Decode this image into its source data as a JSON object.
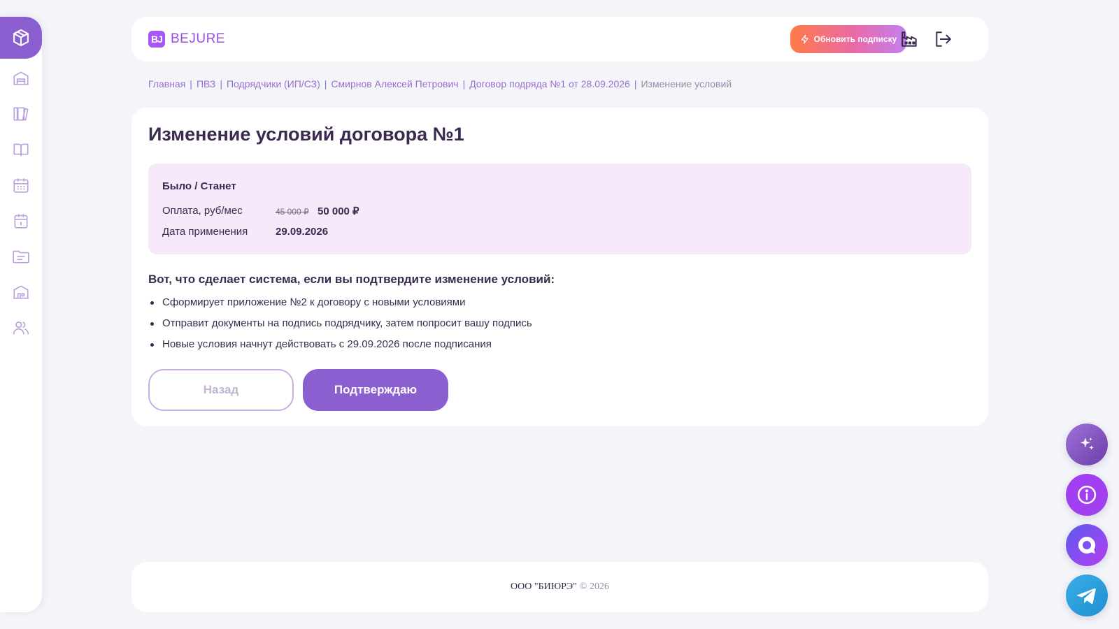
{
  "sidebar": {
    "items": [
      {
        "icon": "box-icon",
        "active": true
      },
      {
        "icon": "warehouse-icon"
      },
      {
        "icon": "library-icon"
      },
      {
        "icon": "book-icon"
      },
      {
        "icon": "calendar-grid-icon"
      },
      {
        "icon": "calendar-day-icon"
      },
      {
        "icon": "folder-icon"
      },
      {
        "icon": "building-icon"
      },
      {
        "icon": "users-icon"
      }
    ]
  },
  "header": {
    "logo_mark": "BJ",
    "logo_text": "BEJURE",
    "upgrade_label": "Обновить подписку",
    "icons": [
      "factory-icon",
      "logout-icon"
    ]
  },
  "breadcrumb": {
    "items": [
      "Главная",
      "ПВЗ",
      "Подрядчики (ИП/СЗ)",
      "Смирнов Алексей Петрович",
      "Договор подряда №1 от 28.09.2026",
      "Изменение условий"
    ],
    "separator": "|"
  },
  "main": {
    "title": "Изменение условий договора №1",
    "compare": {
      "title": "Было / Станет",
      "payment_label": "Оплата, руб/мес",
      "payment_old": "45 000 ₽",
      "payment_new": "50 000 ₽",
      "date_label": "Дата применения",
      "date_value": "29.09.2026"
    },
    "system_title": "Вот, что сделает система, если вы подтвердите изменение условий:",
    "bullets": [
      "Сформирует приложение №2 к договору с новыми условиями",
      "Отправит документы на подпись подрядчику, затем попросит вашу подпись",
      "Новые условия начнут действовать с 29.09.2026 после подписания"
    ],
    "back_label": "Назад",
    "confirm_label": "Подтверждаю"
  },
  "footer": {
    "company": "ООО \"БИЮРЭ\"",
    "copyright": "© 2026"
  },
  "floating": [
    "sparkles-icon",
    "info-icon",
    "chat-icon",
    "telegram-icon"
  ],
  "colors": {
    "accent": "#8b5fd0",
    "text": "#3b2a4f",
    "compare_bg": "#f6eafa",
    "page_bg": "#f3f5f9"
  }
}
